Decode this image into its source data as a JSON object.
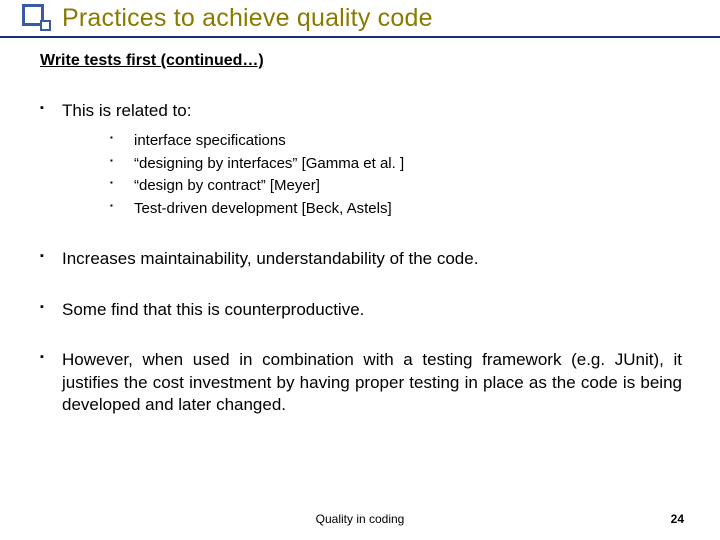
{
  "title": "Practices to achieve quality code",
  "subtitle": "Write tests first (continued…)",
  "bullets": {
    "b1": "This is related to:",
    "b1_subs": {
      "s1": "interface specifications",
      "s2": "“designing by interfaces” [Gamma et al. ]",
      "s3": "“design by contract” [Meyer]",
      "s4": "Test-driven development [Beck, Astels]"
    },
    "b2": "Increases maintainability, understandability of the code.",
    "b3": "Some find that this is counterproductive.",
    "b4": "However, when used in combination with a testing framework (e.g. JUnit), it justifies the cost investment by having proper testing in place as the code is being developed and later changed."
  },
  "footer": "Quality in coding",
  "page": "24"
}
